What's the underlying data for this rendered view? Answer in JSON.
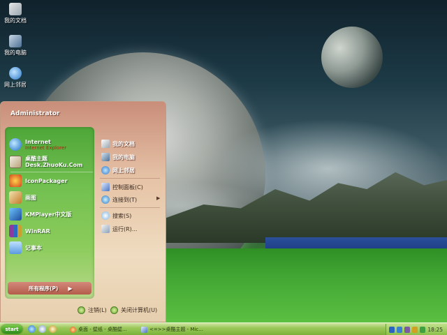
{
  "desktop": {
    "icons": [
      {
        "label": "我的文档",
        "icon": "my-documents-icon"
      },
      {
        "label": "我的电脑",
        "icon": "my-computer-icon"
      },
      {
        "label": "网上邻居",
        "icon": "network-places-icon"
      }
    ]
  },
  "start_menu": {
    "user_name": "Administrator",
    "pinned": [
      {
        "title": "Internet",
        "subtitle": "Internet Explorer",
        "icon": "internet-explorer-icon"
      },
      {
        "title": "桌酷主题",
        "subtitle": "Desk.ZhuoKu.Com",
        "icon": "zhuoku-theme-icon"
      }
    ],
    "recent": [
      {
        "title": "IconPackager",
        "icon": "iconpackager-icon"
      },
      {
        "title": "画图",
        "icon": "paint-icon"
      },
      {
        "title": "KMPlayer中文版",
        "icon": "kmplayer-icon"
      },
      {
        "title": "WinRAR",
        "icon": "winrar-icon"
      },
      {
        "title": "记事本",
        "icon": "notepad-icon"
      }
    ],
    "all_programs_label": "所有程序(P)",
    "places": [
      {
        "label": "我的文档",
        "icon": "my-documents-icon"
      },
      {
        "label": "我的电脑",
        "icon": "my-computer-icon"
      },
      {
        "label": "网上邻居",
        "icon": "network-places-icon"
      }
    ],
    "settings": [
      {
        "label": "控制面板(C)",
        "icon": "control-panel-icon"
      },
      {
        "label": "连接到(T)",
        "icon": "connect-to-icon"
      }
    ],
    "tools": [
      {
        "label": "搜索(S)",
        "icon": "search-icon"
      },
      {
        "label": "运行(R)...",
        "icon": "run-icon"
      }
    ],
    "log_off_label": "注销(L)",
    "shutdown_label": "关闭计算机(U)"
  },
  "taskbar": {
    "start_label": "start",
    "tasks": [
      {
        "label": "桌面 - 壁纸 - 桌酷壁...",
        "icon": "browser-icon"
      },
      {
        "label": "<=>>桌酷主题 - Mic...",
        "icon": "window-icon"
      }
    ],
    "clock": "18:25"
  },
  "colors": {
    "taskbar": "#9cc85a",
    "start_menu_header": "#c98e7a",
    "left_panel": "#72c050",
    "all_programs": "#b45d4c"
  }
}
